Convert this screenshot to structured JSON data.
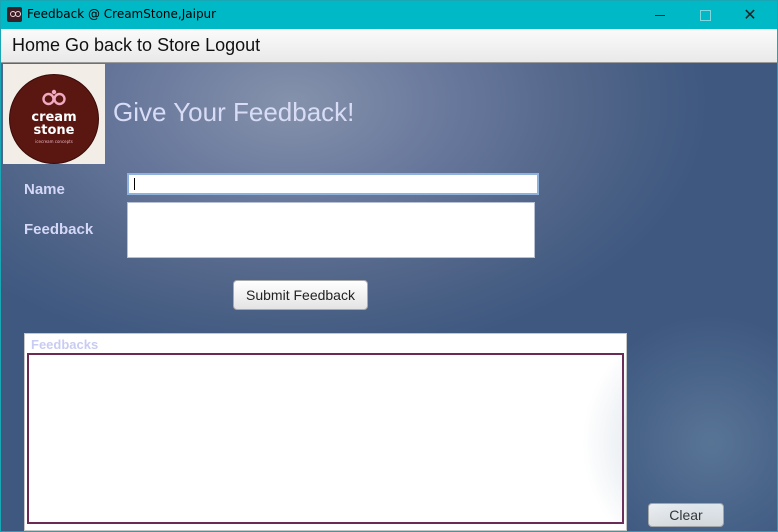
{
  "window": {
    "title": "Feedback @ CreamStone,Jaipur",
    "icons": {
      "app": "creamstone-app-icon",
      "minimize": "minimize-icon",
      "maximize": "maximize-icon",
      "close": "close-icon"
    }
  },
  "menu": {
    "items": [
      {
        "label": "Home"
      },
      {
        "label": "Go back to Store"
      },
      {
        "label": "Logout"
      }
    ]
  },
  "logo": {
    "line1": "cream",
    "line2": "stone",
    "tagline": "icecream concepts",
    "colors": {
      "background": "#5a1610",
      "emblem": "#f1a9c2"
    }
  },
  "page": {
    "title": "Give Your Feedback!"
  },
  "form": {
    "name_label": "Name",
    "name_value": "",
    "feedback_label": "Feedback",
    "feedback_value": "",
    "submit_label": "Submit Feedback"
  },
  "feedbacks": {
    "title": "Feedbacks",
    "items": []
  },
  "actions": {
    "clear_label": "Clear"
  },
  "colors": {
    "titlebar": "#00b9c6",
    "label_text": "#d4d7f5",
    "list_border": "#6a2a55"
  }
}
